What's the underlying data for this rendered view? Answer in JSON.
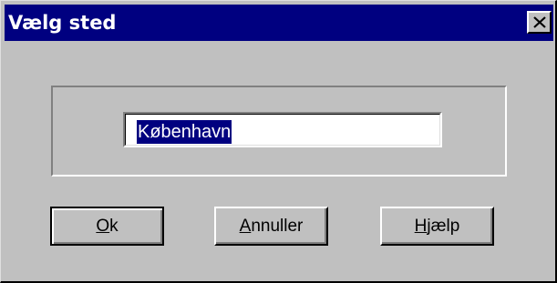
{
  "window": {
    "title": "Vælg sted",
    "close_icon": "close-icon"
  },
  "location_field": {
    "value": "København",
    "selected": true
  },
  "buttons": {
    "ok": {
      "mnemonic": "O",
      "rest": "k",
      "is_default": true
    },
    "cancel": {
      "mnemonic": "A",
      "rest": "nnuller"
    },
    "help": {
      "mnemonic": "H",
      "rest": "jælp"
    }
  },
  "colors": {
    "titlebar": "#000080",
    "dialog_face": "#c0c0c0",
    "selection": "#000080"
  }
}
